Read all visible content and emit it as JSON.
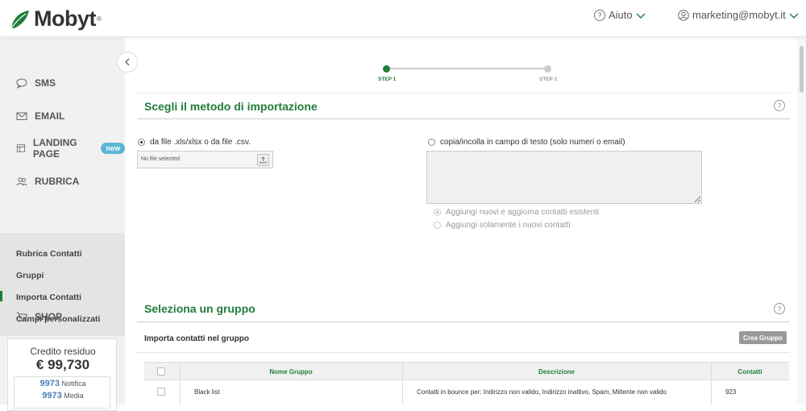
{
  "header": {
    "logo_text": "Mobyt",
    "logo_tm": "®",
    "help_label": "Aiuto",
    "account_email": "marketing@mobyt.it"
  },
  "sidebar": {
    "items": [
      {
        "label": "SMS",
        "icon": "chat-bubble-icon"
      },
      {
        "label": "EMAIL",
        "icon": "envelope-icon"
      },
      {
        "label": "LANDING PAGE",
        "icon": "page-icon",
        "badge": "new"
      },
      {
        "label": "RUBRICA",
        "icon": "contacts-icon"
      },
      {
        "label": "SHOP",
        "icon": "cart-icon"
      }
    ],
    "submenu": [
      {
        "label": "Rubrica Contatti"
      },
      {
        "label": "Gruppi"
      },
      {
        "label": "Importa Contatti",
        "active": true
      },
      {
        "label": "Campi personalizzati"
      }
    ],
    "credit": {
      "label": "Credito residuo",
      "value": "€ 99,730",
      "rows": [
        {
          "count": "9973",
          "type": "Notifica"
        },
        {
          "count": "9973",
          "type": "Media"
        }
      ]
    }
  },
  "steps": [
    {
      "label": "STEP 1",
      "active": true
    },
    {
      "label": "STEP 2",
      "active": false
    }
  ],
  "import_method": {
    "title": "Scegli il metodo di importazione",
    "option_file": "da file .xls/xlsx o da file .csv.",
    "file_placeholder": "No file selected",
    "option_paste": "copia/incolla in campo di testo (solo numeri o email)",
    "sub_options": [
      {
        "label": "Aggiungi nuovi e aggiorna contatti esistenti",
        "selected": true
      },
      {
        "label": "Aggiungi solamente i nuovi contatti",
        "selected": false
      }
    ]
  },
  "group": {
    "title": "Seleziona un gruppo",
    "import_label": "Importa contatti nel gruppo",
    "create_button": "Crea Gruppo",
    "columns": [
      "Nome Gruppo",
      "Descrizione",
      "Contatti"
    ],
    "rows": [
      {
        "name": "Black list",
        "description": "Contatti in bounce per: Indirizzo non valido, Indirizzo inattivo, Spam, Mittente non valido",
        "count": "923"
      }
    ]
  },
  "colors": {
    "brand_green": "#1f7d3a",
    "badge_blue": "#5bb6d3",
    "credit_blue": "#4a7fb5"
  }
}
